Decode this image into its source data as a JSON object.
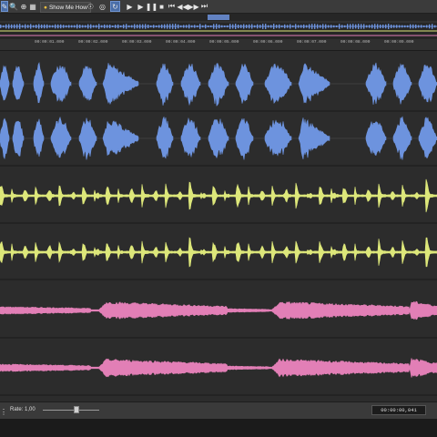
{
  "toolbar": {
    "show_me_how_label": "Show Me How",
    "buttons": [
      "snap-icon",
      "zoom-icon",
      "loop-icon",
      "play-from-start-icon",
      "play-icon",
      "pause-icon",
      "stop-icon",
      "rewind-icon",
      "fast-forward-icon",
      "go-to-end-icon"
    ]
  },
  "ruler": {
    "labels": [
      "00:00:01.000",
      "00:00:02.000",
      "00:00:03.000",
      "00:00:04.000",
      "00:00:05.000",
      "00:00:06.000",
      "00:00:07.000",
      "00:00:08.000",
      "00:00:09.000"
    ]
  },
  "tracks": [
    {
      "name": "track-1-left",
      "color": "#6d93de"
    },
    {
      "name": "track-1-right",
      "color": "#6d93de"
    },
    {
      "name": "track-2-left",
      "color": "#dde77a"
    },
    {
      "name": "track-2-right",
      "color": "#dde77a"
    },
    {
      "name": "track-3-left",
      "color": "#e27fb6"
    },
    {
      "name": "track-3-right",
      "color": "#e27fb6"
    }
  ],
  "statusbar": {
    "rate_label": "Rate: 1,00",
    "rate_value": 1.0,
    "timecode": "00:00:00,041"
  }
}
